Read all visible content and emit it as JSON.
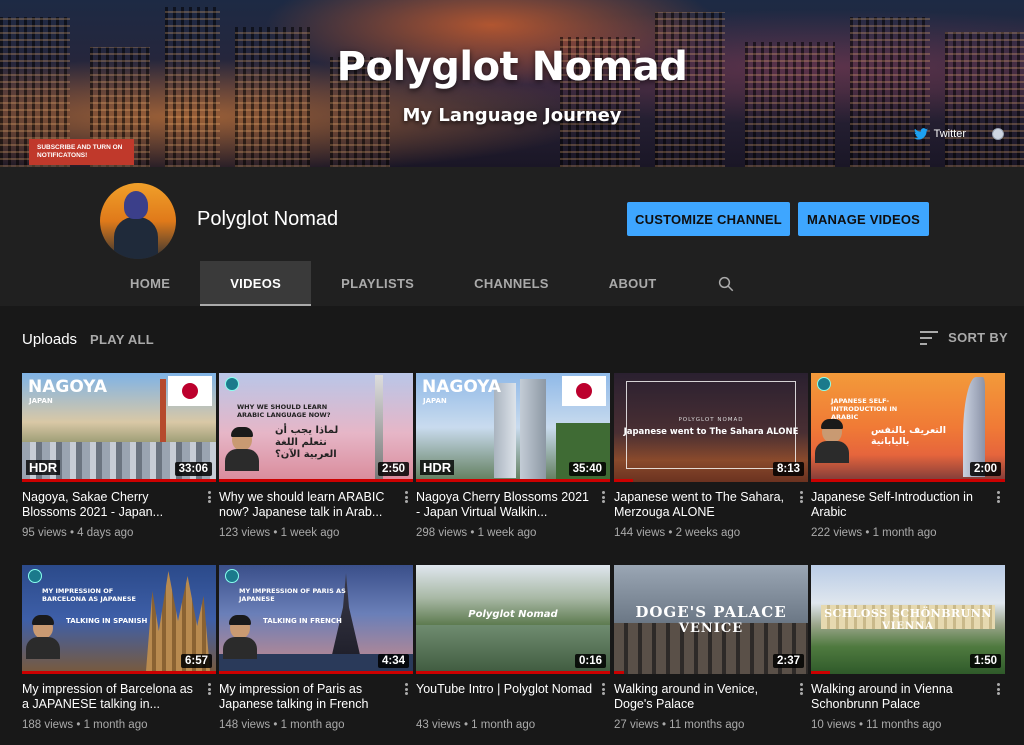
{
  "banner": {
    "title": "Polyglot Nomad",
    "subtitle": "My Language Journey",
    "subscribe_text": "SUBSCRIBE AND TURN ON NOTIFICATONS!",
    "twitter_label": "Twitter"
  },
  "channel": {
    "name": "Polyglot Nomad",
    "customize_label": "CUSTOMIZE CHANNEL",
    "manage_label": "MANAGE VIDEOS"
  },
  "tabs": [
    {
      "label": "HOME"
    },
    {
      "label": "VIDEOS",
      "active": true
    },
    {
      "label": "PLAYLISTS"
    },
    {
      "label": "CHANNELS"
    },
    {
      "label": "ABOUT"
    }
  ],
  "uploads": {
    "title": "Uploads",
    "play_all": "PLAY ALL",
    "sort_by": "SORT BY"
  },
  "videos": [
    {
      "title": "Nagoya, Sakae Cherry Blossoms 2021 - Japan...",
      "views": "95 views",
      "age": "4 days ago",
      "duration": "33:06",
      "thumb_title": "NAGOYA",
      "thumb_sub": "JAPAN",
      "badge": "HDR",
      "watched": 1.0
    },
    {
      "title": "Why we should learn ARABIC now? Japanese talk in Arab...",
      "views": "123 views",
      "age": "1 week ago",
      "duration": "2:50",
      "thumb_title": "WHY WE SHOULD LEARN ARABIC LANGUAGE NOW?",
      "thumb_sub": "لماذا يجب أن نتعلم اللغة العربية الآن؟",
      "watched": 1.0
    },
    {
      "title": "Nagoya Cherry Blossoms 2021 - Japan Virtual Walkin...",
      "views": "298 views",
      "age": "1 week ago",
      "duration": "35:40",
      "thumb_title": "NAGOYA",
      "thumb_sub": "JAPAN",
      "badge": "HDR",
      "watched": 1.0
    },
    {
      "title": "Japanese went to The Sahara, Merzouga ALONE",
      "views": "144 views",
      "age": "2 weeks ago",
      "duration": "8:13",
      "thumb_title": "Japanese went to The Sahara ALONE",
      "thumb_sub": "POLYGLOT NOMAD",
      "watched": 0.1
    },
    {
      "title": "Japanese Self-Introduction in Arabic",
      "views": "222 views",
      "age": "1 month ago",
      "duration": "2:00",
      "thumb_title": "JAPANESE SELF-INTRODUCTION IN ARABIC",
      "thumb_sub": "التعريف بالنفس باليابانية",
      "watched": 1.0
    },
    {
      "title": "My impression of Barcelona as a JAPANESE talking in...",
      "views": "188 views",
      "age": "1 month ago",
      "duration": "6:57",
      "thumb_title": "MY IMPRESSION OF BARCELONA AS JAPANESE",
      "thumb_sub": "TALKING IN SPANISH",
      "watched": 1.0
    },
    {
      "title": "My impression of Paris as Japanese talking in French",
      "views": "148 views",
      "age": "1 month ago",
      "duration": "4:34",
      "thumb_title": "MY IMPRESSION OF PARIS AS JAPANESE",
      "thumb_sub": "TALKING IN FRENCH",
      "watched": 1.0
    },
    {
      "title": "YouTube Intro | Polyglot Nomad",
      "views": "43 views",
      "age": "1 month ago",
      "duration": "0:16",
      "thumb_title": "Polyglot Nomad",
      "thumb_sub": "",
      "watched": 1.0
    },
    {
      "title": "Walking around in Venice, Doge's Palace",
      "views": "27 views",
      "age": "11 months ago",
      "duration": "2:37",
      "thumb_title": "DOGE'S PALACE",
      "thumb_sub": "VENICE",
      "watched": 0.05
    },
    {
      "title": "Walking around in Vienna Schonbrunn Palace",
      "views": "10 views",
      "age": "11 months ago",
      "duration": "1:50",
      "thumb_title": "SCHLOSS SCHÖNBRUNN",
      "thumb_sub": "VIENNA",
      "watched": 0.1
    }
  ],
  "colors": {
    "accent": "#3ea6ff",
    "progress": "#cc0000",
    "background": "#181818",
    "header": "#202020"
  }
}
